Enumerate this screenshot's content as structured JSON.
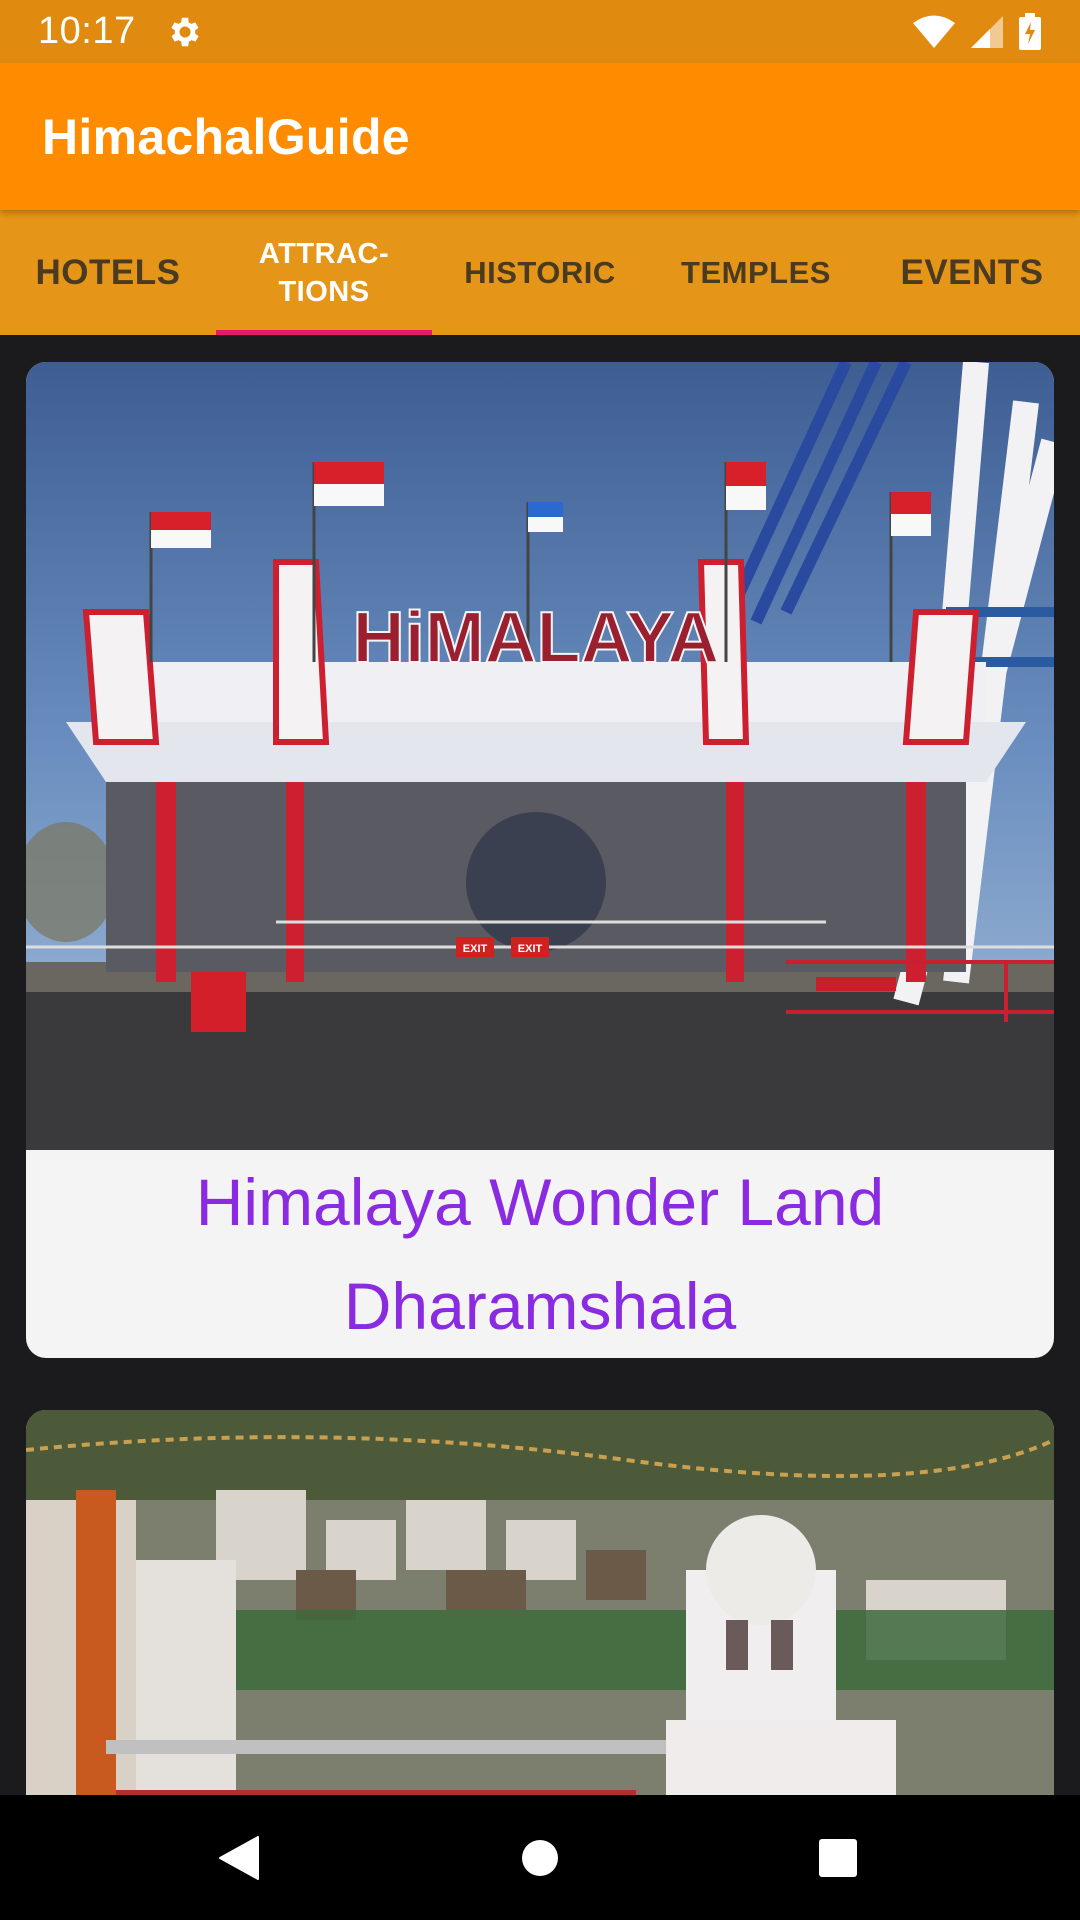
{
  "status_bar": {
    "time": "10:17",
    "icons": [
      "gear-icon",
      "wifi-icon",
      "signal-icon",
      "battery-icon"
    ]
  },
  "app_bar": {
    "title": "HimachalGuide",
    "color": "#ff8c00"
  },
  "tabs": [
    {
      "label": "HOTELS",
      "active": false
    },
    {
      "label": "ATTRAC-\nTIONS",
      "active": true
    },
    {
      "label": "HISTORIC",
      "active": false
    },
    {
      "label": "TEMPLES",
      "active": false
    },
    {
      "label": "EVENTS",
      "active": false
    }
  ],
  "tab_indicator_color": "#e5186a",
  "cards": [
    {
      "sign_text": "HiMALAYA",
      "exit_sign": "EXIT",
      "caption": "Himalaya Wonder Land Dharamshala"
    },
    {
      "caption": ""
    }
  ],
  "caption_color": "#8a2be2",
  "nav_bar": {
    "icons": [
      "back-icon",
      "home-icon",
      "recents-icon"
    ]
  }
}
